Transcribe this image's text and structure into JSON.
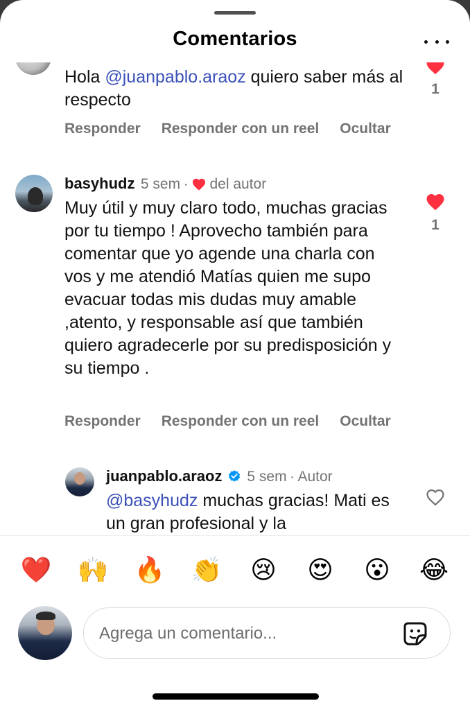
{
  "header": {
    "title": "Comentarios",
    "more_icon": "more-horizontal-icon"
  },
  "comments": [
    {
      "text_before": "Hola ",
      "mention": "@juanpablo.araoz",
      "text_after": " quiero saber más al respecto",
      "likes": "1",
      "actions": {
        "reply": "Responder",
        "reply_reel": "Responder con un reel",
        "hide": "Ocultar"
      }
    },
    {
      "username": "basyhudz",
      "time": "5 sem",
      "sep": "·",
      "author_like": "del autor",
      "text": "Muy útil y muy claro todo, muchas gracias por tu tiempo ! Aprovecho también para comentar que yo agende una charla con vos y me atendió Matías quien me supo evacuar todas mis dudas muy amable ,atento, y responsable así que también quiero agradecerle por su predisposición y su tiempo .",
      "likes": "1",
      "actions": {
        "reply": "Responder",
        "reply_reel": "Responder con un reel",
        "hide": "Ocultar"
      }
    },
    {
      "username": "juanpablo.araoz",
      "time": "5 sem",
      "sep": "·",
      "badge": "Autor",
      "mention": "@basyhudz",
      "text_after": " muchas gracias! Mati es un gran profesional y la"
    }
  ],
  "emoji_bar": [
    "❤️",
    "🙌",
    "🔥",
    "👏",
    "😢",
    "😍",
    "😮",
    "😂"
  ],
  "composer": {
    "placeholder": "Agrega un comentario...",
    "sticker_icon": "sticker-icon"
  },
  "colors": {
    "like_red": "#ff3040",
    "mention_blue": "#3b51b9",
    "verified_blue": "#0095f6",
    "secondary_gray": "#737373"
  }
}
